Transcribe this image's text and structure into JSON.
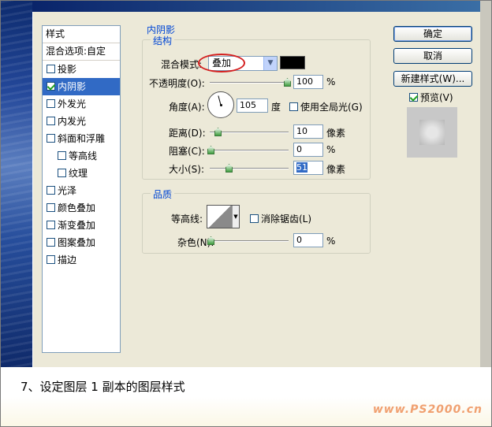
{
  "styles_panel": {
    "header": "样式",
    "blend_options": "混合选项:自定",
    "items": [
      {
        "label": "投影",
        "checked": false,
        "indent": false,
        "selected": false
      },
      {
        "label": "内阴影",
        "checked": true,
        "indent": false,
        "selected": true
      },
      {
        "label": "外发光",
        "checked": false,
        "indent": false,
        "selected": false
      },
      {
        "label": "内发光",
        "checked": false,
        "indent": false,
        "selected": false
      },
      {
        "label": "斜面和浮雕",
        "checked": false,
        "indent": false,
        "selected": false
      },
      {
        "label": "等高线",
        "checked": false,
        "indent": true,
        "selected": false
      },
      {
        "label": "纹理",
        "checked": false,
        "indent": true,
        "selected": false
      },
      {
        "label": "光泽",
        "checked": false,
        "indent": false,
        "selected": false
      },
      {
        "label": "颜色叠加",
        "checked": false,
        "indent": false,
        "selected": false
      },
      {
        "label": "渐变叠加",
        "checked": false,
        "indent": false,
        "selected": false
      },
      {
        "label": "图案叠加",
        "checked": false,
        "indent": false,
        "selected": false
      },
      {
        "label": "描边",
        "checked": false,
        "indent": false,
        "selected": false
      }
    ]
  },
  "inner_shadow": {
    "title": "内阴影",
    "structure": {
      "title": "结构",
      "blend_mode_label": "混合模式:",
      "blend_mode_value": "叠加",
      "color": "#000000",
      "opacity_label": "不透明度(O):",
      "opacity_value": "100",
      "opacity_unit": "%",
      "angle_label": "角度(A):",
      "angle_value": "105",
      "angle_unit": "度",
      "global_light_label": "使用全局光(G)",
      "global_light_checked": false,
      "distance_label": "距离(D):",
      "distance_value": "10",
      "distance_unit": "像素",
      "choke_label": "阻塞(C):",
      "choke_value": "0",
      "choke_unit": "%",
      "size_label": "大小(S):",
      "size_value": "51",
      "size_unit": "像素"
    },
    "quality": {
      "title": "品质",
      "contour_label": "等高线:",
      "antialias_label": "消除锯齿(L)",
      "antialias_checked": false,
      "noise_label": "杂色(N):",
      "noise_value": "0",
      "noise_unit": "%"
    }
  },
  "buttons": {
    "ok": "确定",
    "cancel": "取消",
    "new_style": "新建样式(W)...",
    "preview_label": "预览(V)",
    "preview_checked": true
  },
  "caption": "7、设定图层 1 副本的图层样式",
  "watermark": "www.PS2000.cn"
}
